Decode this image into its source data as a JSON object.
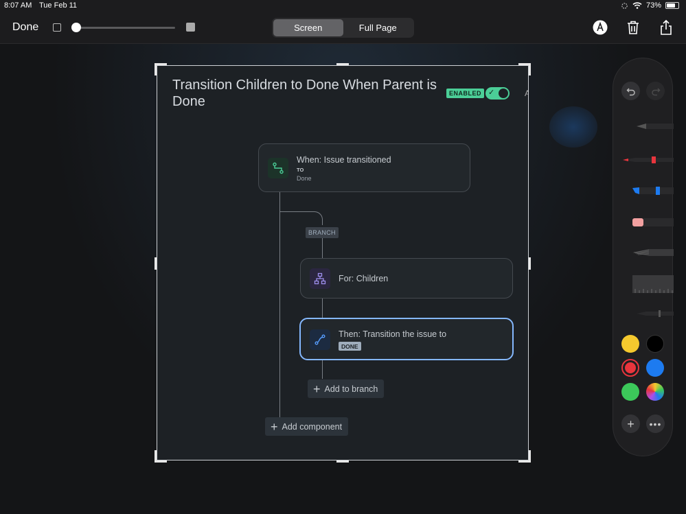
{
  "status_bar": {
    "time": "8:07 AM",
    "date": "Tue Feb 11",
    "battery": "73%",
    "battery_level": 0.73
  },
  "toolbar": {
    "done_label": "Done",
    "modes": [
      "Screen",
      "Full Page"
    ],
    "active_mode": "Screen",
    "icons": [
      "markup-pen-icon",
      "trash-icon",
      "share-icon"
    ]
  },
  "rule": {
    "title": "Transition Children to Done When Parent is Done",
    "status_badge": "ENABLED",
    "toggle_on": true,
    "cut_off_text": "A"
  },
  "flow": {
    "trigger": {
      "title": "When: Issue transitioned",
      "to_label": "TO",
      "to_value": "Done"
    },
    "branch_label": "BRANCH",
    "branch": {
      "title": "For: Children"
    },
    "action": {
      "title": "Then: Transition the issue to",
      "lozenge": "DONE"
    },
    "add_to_branch": "Add to branch",
    "add_component": "Add component"
  },
  "palette": {
    "tools": [
      "pen-tool",
      "marker-tool",
      "highlighter-tool",
      "eraser-tool",
      "pencil-tool",
      "ruler-tool",
      "fountain-pen-tool"
    ],
    "colors": [
      "#f5c92e",
      "#000000",
      "#e8353d",
      "#1d7bf0",
      "#3cc85a",
      "multicolor"
    ],
    "selected_color": "#e8353d",
    "colors_meta": {
      "accent": "#4bce97",
      "selection": "#85b8ff"
    }
  }
}
